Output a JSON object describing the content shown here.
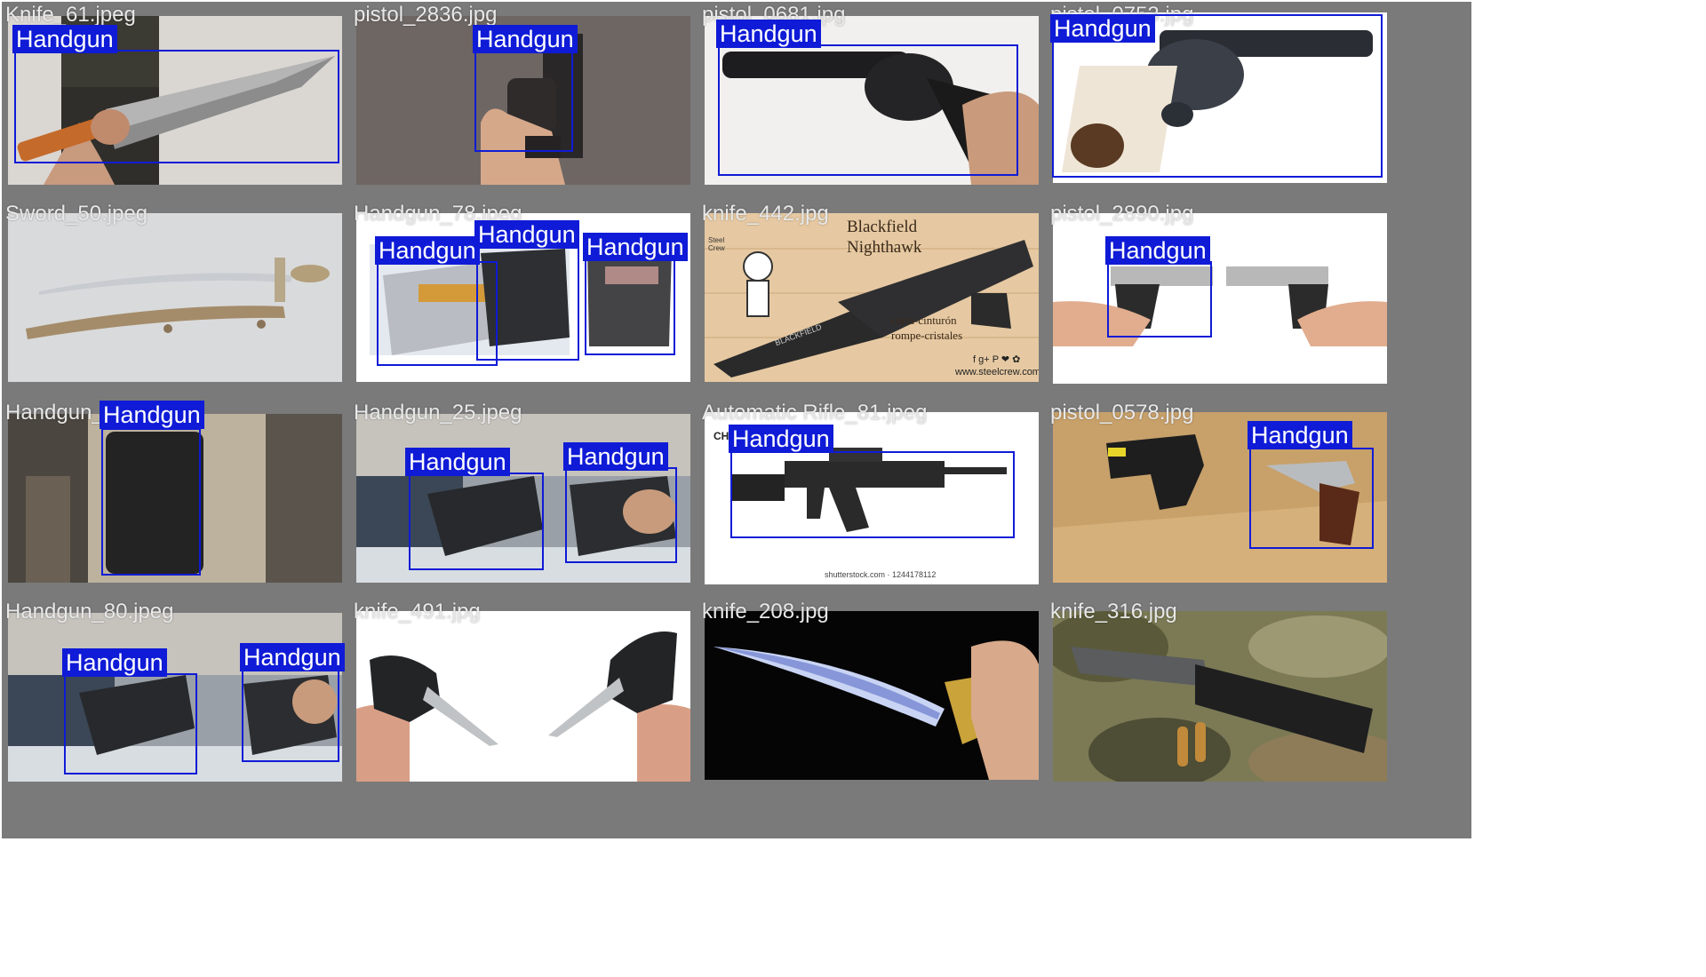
{
  "colors": {
    "tile_frame": "#7a7a7a",
    "box": "#0f1bd6",
    "label_bg": "#0f1bd6",
    "label_text": "#ffffff",
    "filename_text": "#e8e8e8"
  },
  "tiles": [
    {
      "filename": "Knife_61.jpeg",
      "labels": [
        "Handgun"
      ]
    },
    {
      "filename": "pistol_2836.jpg",
      "labels": [
        "Handgun"
      ]
    },
    {
      "filename": "pistol_0681.jpg",
      "labels": [
        "Handgun"
      ]
    },
    {
      "filename": "pistol_0753.jpg",
      "labels": [
        "Handgun"
      ]
    },
    {
      "filename": "Sword_50.jpeg",
      "labels": []
    },
    {
      "filename": "Handgun_78.jpeg",
      "labels": [
        "Handgun",
        "Handgun",
        "Handgun"
      ],
      "photo_text": {
        "line1": ""
      }
    },
    {
      "filename": "knife_442.jpg",
      "labels": [],
      "photo_text": {
        "title1": "Blackfield",
        "title2": "Nighthawk",
        "line1": "corta-cinturón",
        "line2": "rompe-cristales",
        "url": "www.steelcrew.com",
        "brand": "BLACKFIELD",
        "crew": "Steel Crew",
        "social": "f g+ P ❤ ✿"
      }
    },
    {
      "filename": "pistol_2890.jpg",
      "labels": [
        "Handgun"
      ]
    },
    {
      "filename": "Handgun_",
      "labels": [
        "Handgun"
      ]
    },
    {
      "filename": "Handgun_25.jpeg",
      "labels": [
        "Handgun",
        "Handgun"
      ]
    },
    {
      "filename": "Automatic Rifle_81.jpeg",
      "labels": [
        "Handgun"
      ],
      "photo_text": {
        "credit": "shutterstock.com · 1244178112",
        "corner": "CHI"
      }
    },
    {
      "filename": "pistol_0578.jpg",
      "labels": [
        "Handgun"
      ]
    },
    {
      "filename": "Handgun_80.jpeg",
      "labels": [
        "Handgun",
        "Handgun"
      ]
    },
    {
      "filename": "knife_491.jpg",
      "labels": []
    },
    {
      "filename": "knife_208.jpg",
      "labels": []
    },
    {
      "filename": "knife_316.jpg",
      "labels": []
    }
  ]
}
